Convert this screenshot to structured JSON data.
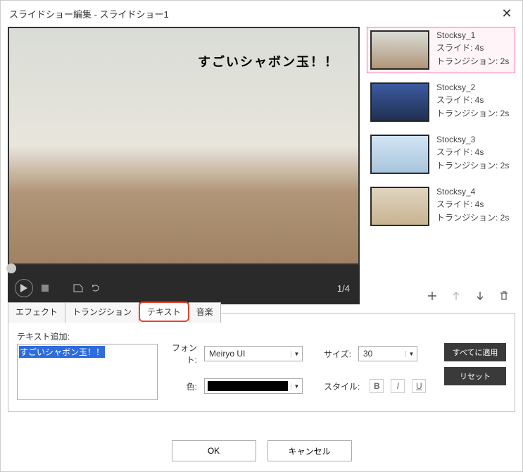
{
  "window": {
    "title": "スライドショー編集  -  スライドショー1"
  },
  "preview": {
    "overlay_text": "すごいシャボン玉！！",
    "counter": "1/4"
  },
  "slides": [
    {
      "name": "Stocksy_1",
      "duration": "スライド: 4s",
      "transition": "トランジション: 2s"
    },
    {
      "name": "Stocksy_2",
      "duration": "スライド: 4s",
      "transition": "トランジション: 2s"
    },
    {
      "name": "Stocksy_3",
      "duration": "スライド: 4s",
      "transition": "トランジション: 2s"
    },
    {
      "name": "Stocksy_4",
      "duration": "スライド: 4s",
      "transition": "トランジション: 2s"
    }
  ],
  "tabs": {
    "effect": "エフェクト",
    "transition": "トランジション",
    "text": "テキスト",
    "music": "音楽"
  },
  "text_panel": {
    "add_label": "テキスト追加:",
    "text_value": "すごいシャボン玉！！",
    "font_label": "フォント:",
    "font_value": "Meiryo UI",
    "size_label": "サイズ:",
    "size_value": "30",
    "color_label": "色:",
    "color_value": "#000000",
    "style_label": "スタイル:",
    "style_bold": "B",
    "style_italic": "I",
    "style_underline": "U",
    "apply_all": "すべてに適用",
    "reset": "リセット"
  },
  "footer": {
    "ok": "OK",
    "cancel": "キャンセル"
  }
}
